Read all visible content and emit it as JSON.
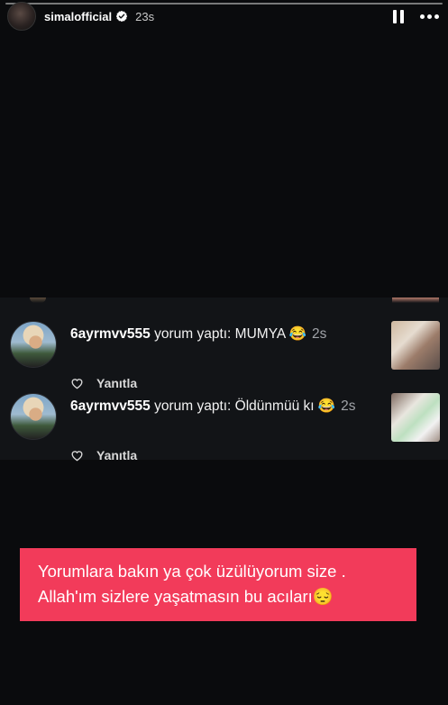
{
  "story": {
    "username": "simalofficial",
    "verified": true,
    "time": "23s",
    "progress_fraction": 0.0
  },
  "icons": {
    "verified": "verified-badge-icon",
    "pause": "pause-icon",
    "more": "more-horizontal-icon",
    "like": "heart-outline-icon"
  },
  "comments": [
    {
      "user": "6ayrmvv555",
      "text": " yorum yaptı: MUMYA 😂",
      "ago": "2s",
      "reply_label": "Yanıtla"
    },
    {
      "user": "6ayrmvv555",
      "text": " yorum yaptı: Öldünmüü kı 😂",
      "ago": "2s",
      "reply_label": "Yanıtla"
    }
  ],
  "caption": {
    "line1": "Yorumlara bakın ya  çok üzülüyorum size  .",
    "line2": "Allah'ım sizlere yaşatmasın bu acıları😔"
  },
  "colors": {
    "background": "#0a0b0d",
    "caption_bg": "#f23b5a",
    "muted_text": "#a0a3a8"
  }
}
